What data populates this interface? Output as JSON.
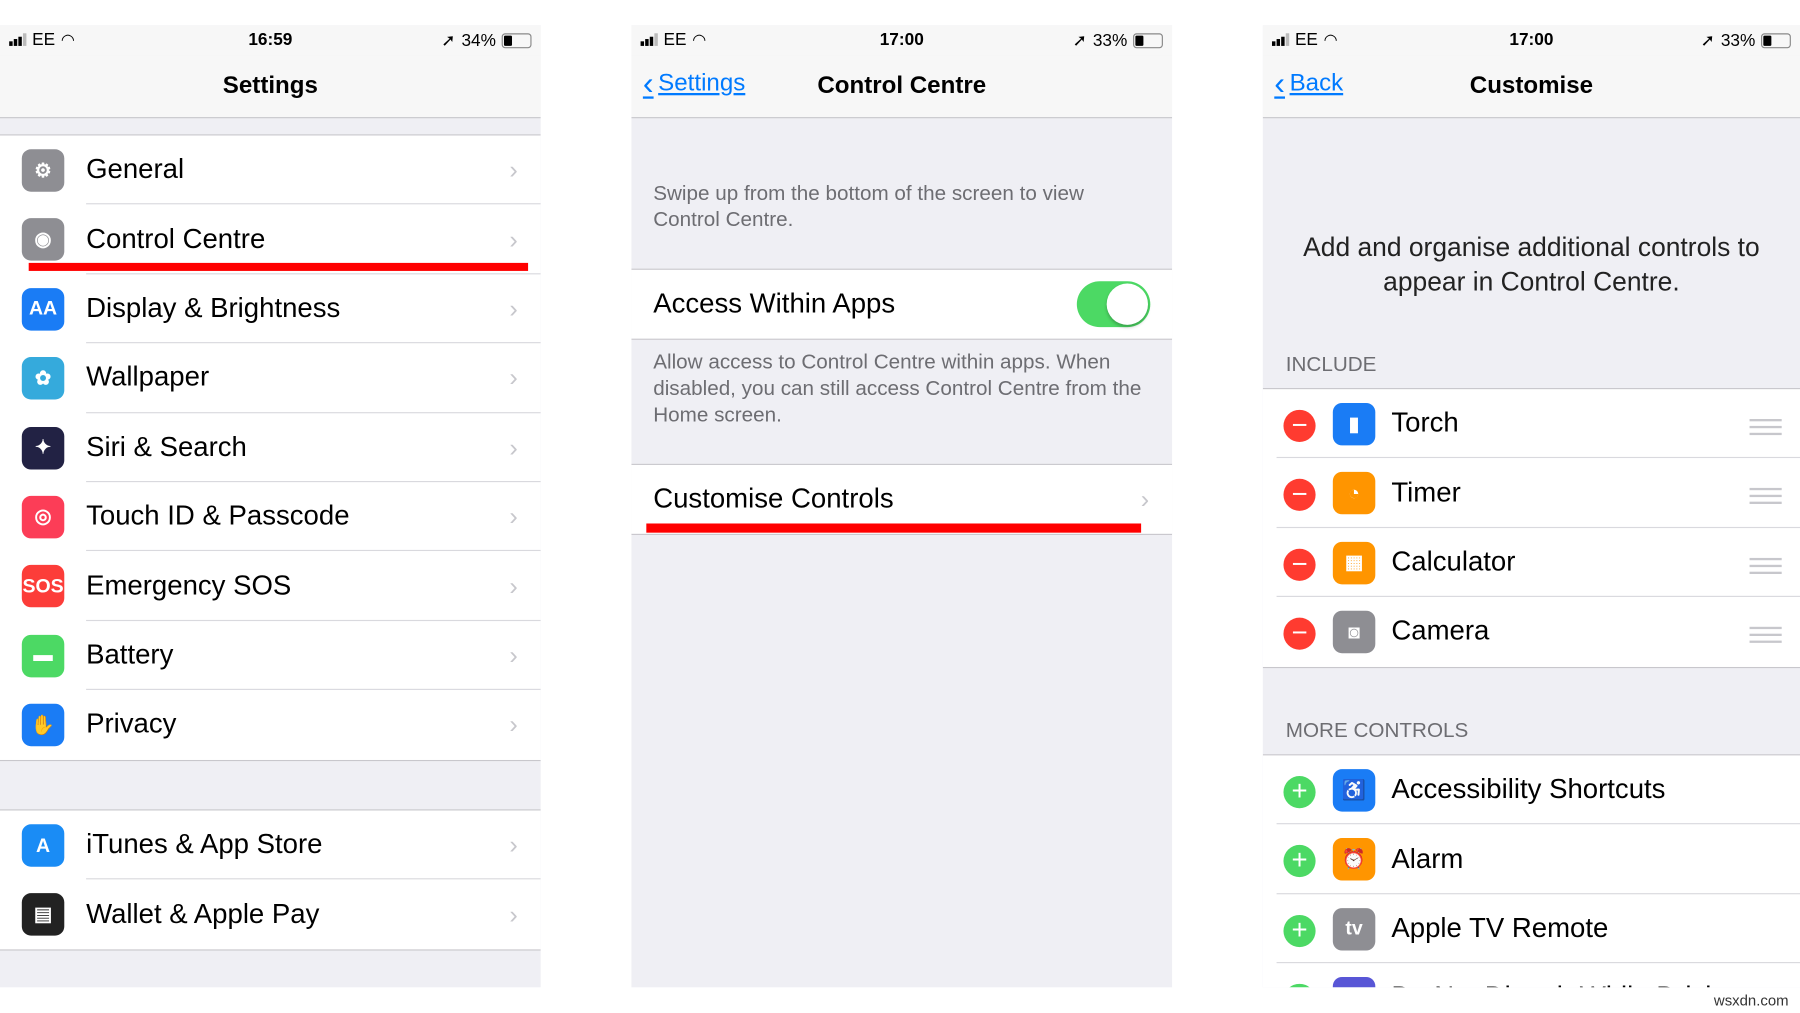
{
  "panels": [
    {
      "status": {
        "carrier": "EE",
        "time": "16:59",
        "battery": "34%",
        "battery_level": 0.34
      },
      "nav": {
        "title": "Settings"
      },
      "groups": [
        [
          {
            "label": "General",
            "icon": "gear-icon",
            "color": "#8e8e93",
            "glyph": "⚙"
          },
          {
            "label": "Control Centre",
            "icon": "control-centre-icon",
            "color": "#8e8e93",
            "glyph": "◉"
          },
          {
            "label": "Display & Brightness",
            "icon": "display-icon",
            "color": "#1a7cf5",
            "glyph": "AA"
          },
          {
            "label": "Wallpaper",
            "icon": "wallpaper-icon",
            "color": "#35aadc",
            "glyph": "✿"
          },
          {
            "label": "Siri & Search",
            "icon": "siri-icon",
            "color": "#222244",
            "glyph": "✦"
          },
          {
            "label": "Touch ID & Passcode",
            "icon": "fingerprint-icon",
            "color": "#fc3d57",
            "glyph": "◎"
          },
          {
            "label": "Emergency SOS",
            "icon": "sos-icon",
            "color": "#fc3d39",
            "glyph": "SOS"
          },
          {
            "label": "Battery",
            "icon": "battery-icon",
            "color": "#4cd964",
            "glyph": "▬"
          },
          {
            "label": "Privacy",
            "icon": "hand-icon",
            "color": "#1a7cf5",
            "glyph": "✋"
          }
        ],
        [
          {
            "label": "iTunes & App Store",
            "icon": "app-store-icon",
            "color": "#1a8cf5",
            "glyph": "A"
          },
          {
            "label": "Wallet & Apple Pay",
            "icon": "wallet-icon",
            "color": "#222",
            "glyph": "▤"
          }
        ]
      ]
    },
    {
      "status": {
        "carrier": "EE",
        "time": "17:00",
        "battery": "33%",
        "battery_level": 0.33
      },
      "nav": {
        "title": "Control Centre",
        "back": "Settings"
      },
      "intro": "Swipe up from the bottom of the screen to view Control Centre.",
      "access": {
        "label": "Access Within Apps",
        "enabled": true
      },
      "access_footer": "Allow access to Control Centre within apps. When disabled, you can still access Control Centre from the Home screen.",
      "customise": "Customise Controls"
    },
    {
      "status": {
        "carrier": "EE",
        "time": "17:00",
        "battery": "33%",
        "battery_level": 0.33
      },
      "nav": {
        "title": "Customise",
        "back": "Back"
      },
      "intro": "Add and organise additional controls to appear in Control Centre.",
      "include_header": "INCLUDE",
      "include": [
        {
          "label": "Torch",
          "icon": "torch-icon",
          "color": "#1a7cf5",
          "glyph": "▮"
        },
        {
          "label": "Timer",
          "icon": "timer-icon",
          "color": "#ff9500",
          "glyph": "◔"
        },
        {
          "label": "Calculator",
          "icon": "calculator-icon",
          "color": "#ff9500",
          "glyph": "▦"
        },
        {
          "label": "Camera",
          "icon": "camera-icon",
          "color": "#8e8e93",
          "glyph": "◙"
        }
      ],
      "more_header": "MORE CONTROLS",
      "more": [
        {
          "label": "Accessibility Shortcuts",
          "icon": "accessibility-icon",
          "color": "#1a7cf5",
          "glyph": "♿"
        },
        {
          "label": "Alarm",
          "icon": "alarm-icon",
          "color": "#ff9500",
          "glyph": "⏰"
        },
        {
          "label": "Apple TV Remote",
          "icon": "apple-tv-icon",
          "color": "#8e8e93",
          "glyph": "tv"
        },
        {
          "label": "Do Not Disturb While Driving",
          "icon": "car-icon",
          "color": "#5856d6",
          "glyph": "🚗"
        }
      ]
    }
  ],
  "watermark": "wsxdn.com"
}
